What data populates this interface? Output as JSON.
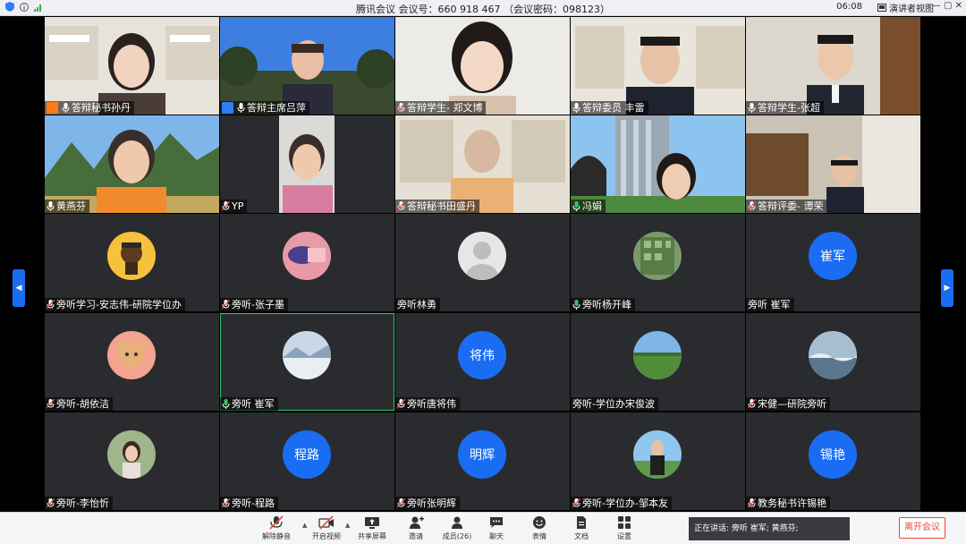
{
  "titlebar": {
    "title": "腾讯会议 会议号：660 918 467 （会议密码：098123）",
    "time": "06:08",
    "speaker_view": "演讲者视图",
    "win_btns": "— ▢ ✕"
  },
  "participants": [
    {
      "name": "答辩秘书孙丹"
    },
    {
      "name": "答辩主席吕萍"
    },
    {
      "name": "答辩学生- 郑文博"
    },
    {
      "name": "答辩委员 丰雷"
    },
    {
      "name": "答辩学生-张超"
    },
    {
      "name": "黄燕芬"
    },
    {
      "name": "YP"
    },
    {
      "name": "答辩秘书田盛丹"
    },
    {
      "name": "冯娟"
    },
    {
      "name": "答辩评委- 谭荣"
    },
    {
      "name": "旁听学习-安志伟-研院学位办"
    },
    {
      "name": "旁听-张子墨"
    },
    {
      "name": "旁听林勇"
    },
    {
      "name": "旁听杨开峰"
    },
    {
      "name": "旁听 崔军",
      "avatar_text": "崔军"
    },
    {
      "name": "旁听-胡依洁"
    },
    {
      "name": "旁听 崔军"
    },
    {
      "name": "旁听唐将伟",
      "avatar_text": "将伟"
    },
    {
      "name": "旁听-学位办宋俊波"
    },
    {
      "name": "宋健—研院旁听"
    },
    {
      "name": "旁听-李怡忻"
    },
    {
      "name": "旁听-程路",
      "avatar_text": "程路"
    },
    {
      "name": "旁听张明辉",
      "avatar_text": "明辉"
    },
    {
      "name": "旁听-学位办-邹本友"
    },
    {
      "name": "教务秘书许锡艳",
      "avatar_text": "锡艳"
    }
  ],
  "toolbar": {
    "unmute": "解除静音",
    "start_video": "开启视频",
    "share_screen": "共享屏幕",
    "invite": "邀请",
    "members": "成员(26)",
    "chat": "聊天",
    "reactions": "表情",
    "docs": "文档",
    "settings": "设置",
    "speaking": "正在讲话: 旁听 崔军; 黄燕芬;",
    "leave": "离开会议"
  },
  "colors": {
    "accent": "#1a6df2",
    "leave": "#e84c3d",
    "active_border": "#39c36a"
  }
}
